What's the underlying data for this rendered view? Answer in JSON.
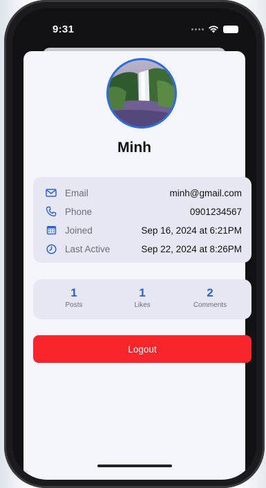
{
  "status_bar": {
    "time": "9:31"
  },
  "profile": {
    "name": "Minh",
    "avatar": "waterfall-photo"
  },
  "info": [
    {
      "icon": "envelope-icon",
      "label": "Email",
      "value": "minh@gmail.com"
    },
    {
      "icon": "phone-icon",
      "label": "Phone",
      "value": "0901234567"
    },
    {
      "icon": "calendar-icon",
      "label": "Joined",
      "value": "Sep 16, 2024 at 6:21PM"
    },
    {
      "icon": "clock-icon",
      "label": "Last Active",
      "value": "Sep 22, 2024 at 8:26PM"
    }
  ],
  "stats": [
    {
      "value": "1",
      "label": "Posts"
    },
    {
      "value": "1",
      "label": "Likes"
    },
    {
      "value": "2",
      "label": "Comments"
    }
  ],
  "logout": {
    "label": "Logout"
  },
  "colors": {
    "accent": "#2a63d6",
    "danger": "#f8262b",
    "card": "#e7e7f3",
    "sheet": "#f4f6fb"
  }
}
